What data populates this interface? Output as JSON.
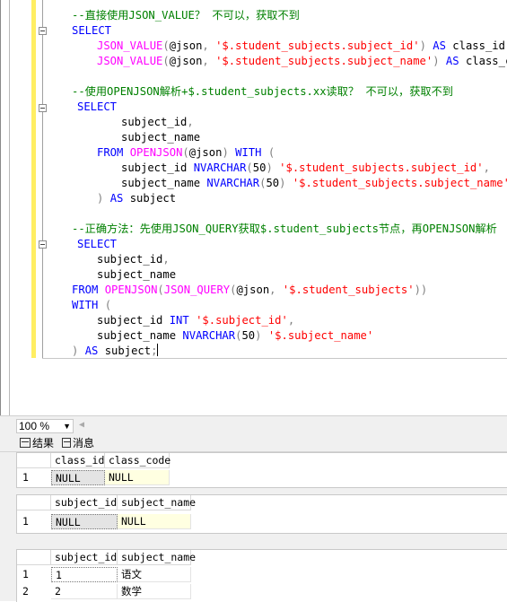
{
  "editor": {
    "comment1": "--直接使用JSON_VALUE？ 不可以，获取不到",
    "comment2": "--使用OPENJSON解析+$.student_subjects.xx读取？ 不可以，获取不到",
    "comment3": "--正确方法：先使用JSON_QUERY获取$.student_subjects节点，再OPENJSON解析",
    "kw_select": "SELECT",
    "kw_as": "AS",
    "kw_from": "FROM",
    "kw_with": "WITH",
    "kw_int": "INT",
    "kw_nvarchar": "NVARCHAR",
    "fn_json_value": "JSON_VALUE",
    "fn_openjson": "OPENJSON",
    "fn_json_query": "JSON_QUERY",
    "var_json": "@json",
    "str_subject_id_path": "'$.student_subjects.subject_id'",
    "str_subject_name_path": "'$.student_subjects.subject_name'",
    "str_subjects_path": "'$.student_subjects'",
    "str_rel_id": "'$.subject_id'",
    "str_rel_name": "'$.subject_name'",
    "id_class_id": "class_id",
    "id_class_code": "class_code",
    "id_subject_id": "subject_id",
    "id_subject_name": "subject_name",
    "id_subject": "subject",
    "num_50": "50"
  },
  "statusbar": {
    "zoom": "100 %"
  },
  "tabs": {
    "results_label": "结果",
    "messages_label": "消息"
  },
  "results": [
    {
      "columns": [
        "class_id",
        "class_code"
      ],
      "rows": [
        [
          "1",
          "NULL",
          "NULL"
        ]
      ]
    },
    {
      "columns": [
        "subject_id",
        "subject_name"
      ],
      "rows": [
        [
          "1",
          "NULL",
          "NULL"
        ]
      ]
    },
    {
      "columns": [
        "subject_id",
        "subject_name"
      ],
      "rows": [
        [
          "1",
          "1",
          "语文"
        ],
        [
          "2",
          "2",
          "数学"
        ]
      ]
    }
  ],
  "colors": {
    "keyword": "#0000ff",
    "function": "#ff00ff",
    "string": "#ff0000",
    "comment": "#008000",
    "null_cell": "#ffffe1"
  }
}
